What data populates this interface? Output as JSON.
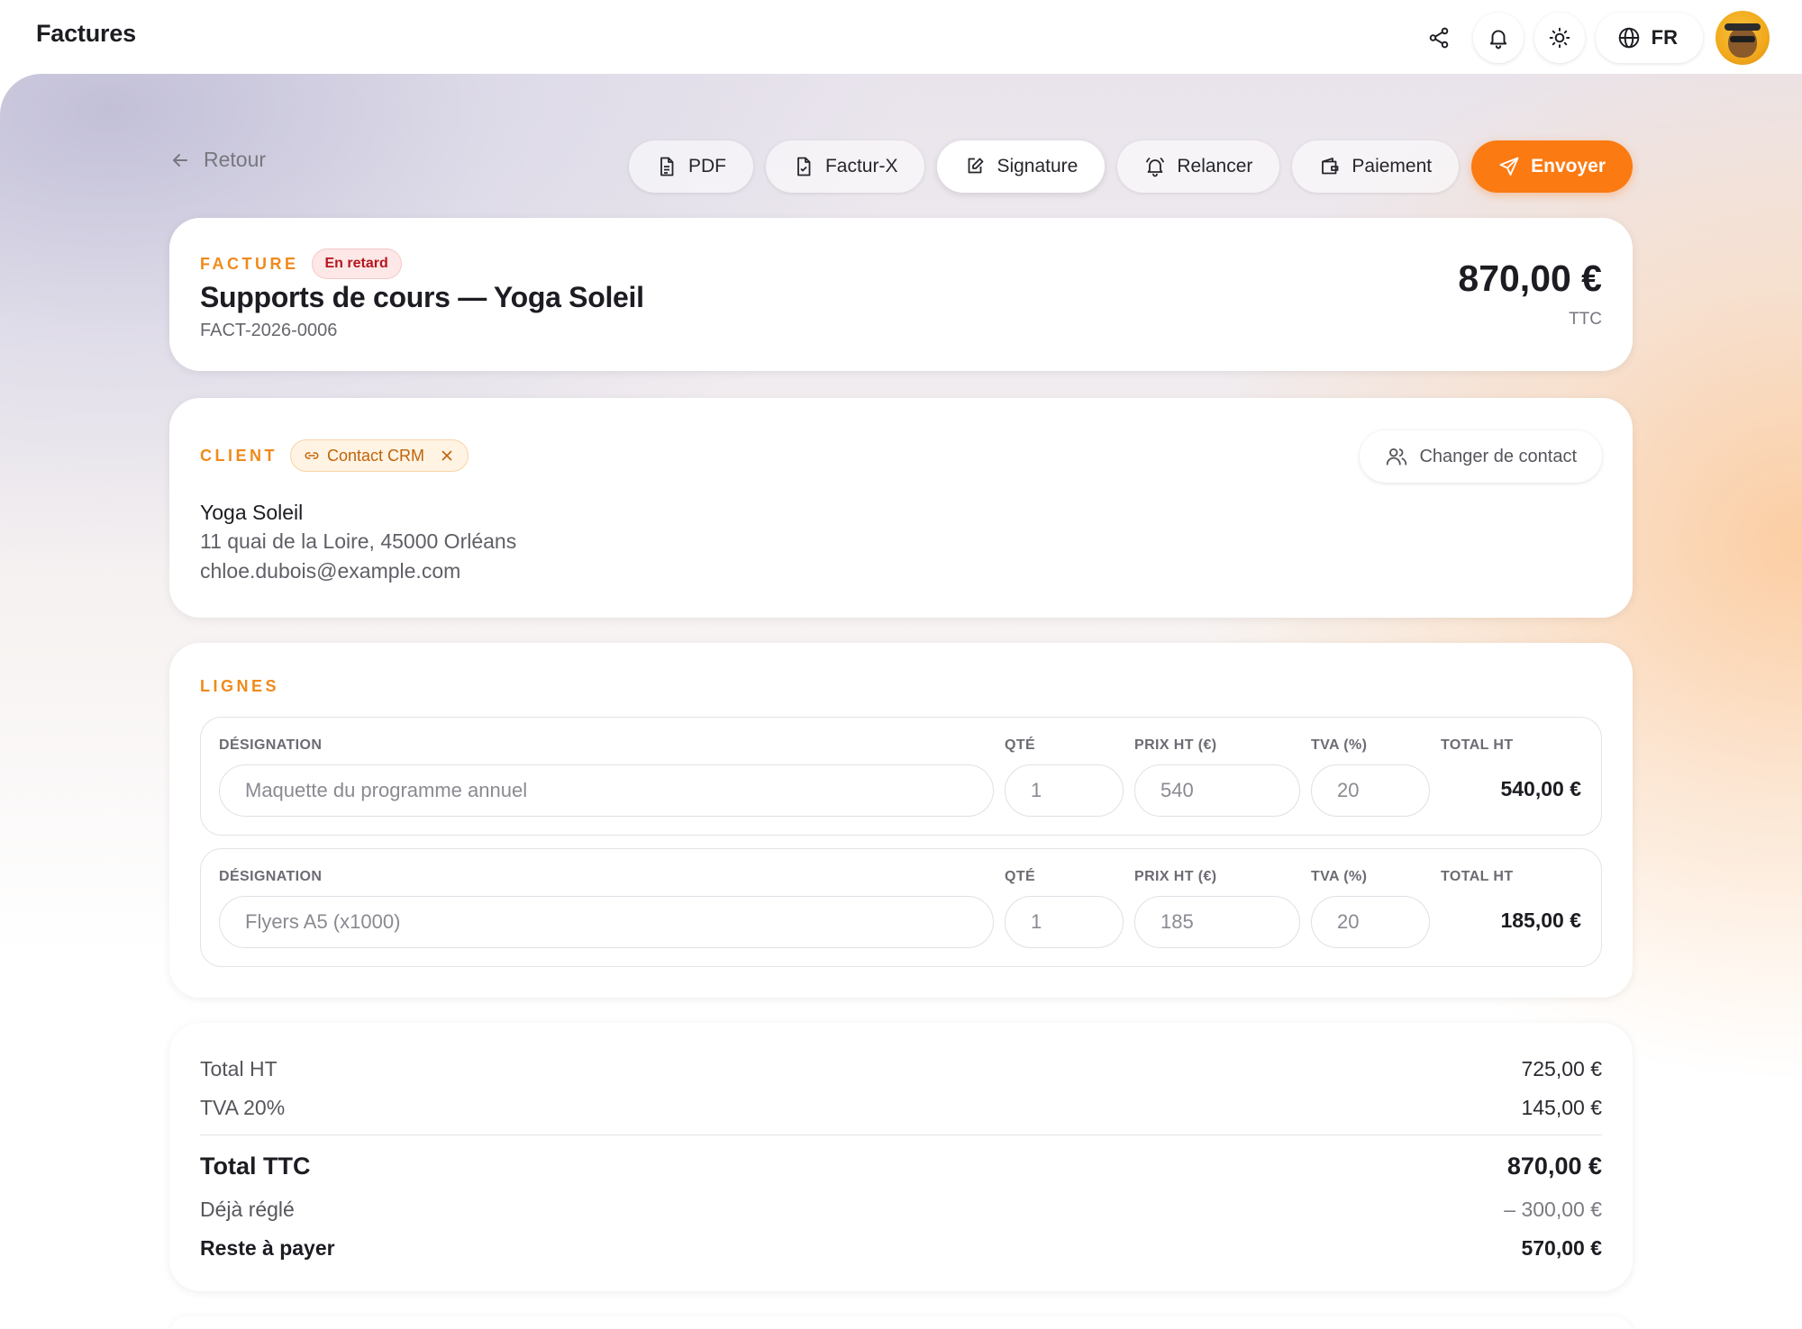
{
  "topbar": {
    "title": "Factures",
    "language": "FR",
    "icons": [
      "share-icon",
      "bell-icon",
      "sun-icon",
      "globe-icon"
    ]
  },
  "toolbar": {
    "back_label": "Retour",
    "pdf_label": "PDF",
    "facturx_label": "Factur-X",
    "signature_label": "Signature",
    "relancer_label": "Relancer",
    "paiement_label": "Paiement",
    "envoyer_label": "Envoyer"
  },
  "invoice": {
    "section_label": "FACTURE",
    "status": "En retard",
    "title": "Supports de cours — Yoga Soleil",
    "reference": "FACT-2026-0006",
    "amount": "870,00 €",
    "amount_suffix": "TTC"
  },
  "client": {
    "section_label": "CLIENT",
    "chip_label": "Contact CRM",
    "change_label": "Changer de contact",
    "name": "Yoga Soleil",
    "address": "11 quai de la Loire, 45000 Orléans",
    "email": "chloe.dubois@example.com"
  },
  "lines": {
    "section_label": "LIGNES",
    "headers": {
      "designation": "DÉSIGNATION",
      "qty": "QTÉ",
      "price": "PRIX HT (€)",
      "vat": "TVA (%)",
      "total": "TOTAL HT"
    },
    "rows": [
      {
        "designation": "Maquette du programme annuel",
        "qty": "1",
        "price": "540",
        "vat": "20",
        "total": "540,00 €"
      },
      {
        "designation": "Flyers A5 (x1000)",
        "qty": "1",
        "price": "185",
        "vat": "20",
        "total": "185,00 €"
      }
    ]
  },
  "totals": {
    "total_ht_label": "Total HT",
    "total_ht": "725,00 €",
    "tva_label": "TVA 20%",
    "tva": "145,00 €",
    "total_ttc_label": "Total TTC",
    "total_ttc": "870,00 €",
    "paid_label": "Déjà réglé",
    "paid": "– 300,00 €",
    "remaining_label": "Reste à payer",
    "remaining": "570,00 €"
  },
  "colors": {
    "accent": "#fb7a12",
    "section_label": "#f08a1b",
    "late_badge": "#b4161e"
  }
}
